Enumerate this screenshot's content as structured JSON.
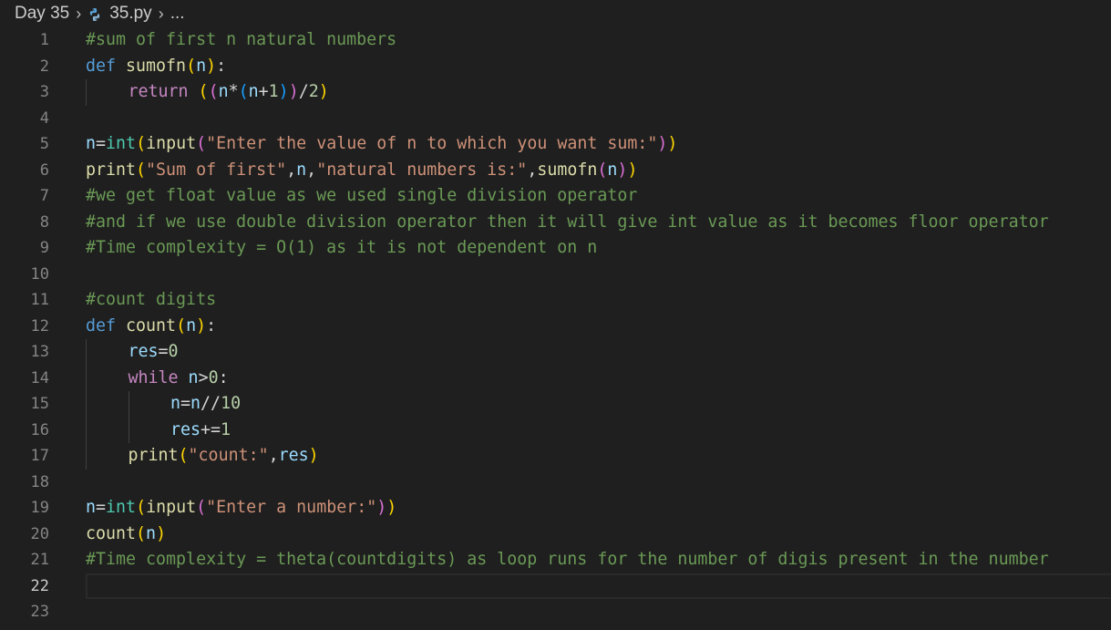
{
  "breadcrumb": {
    "folder": "Day 35",
    "file": "35.py",
    "more": "...",
    "file_icon": "python-file-icon",
    "separator_icon": "chevron-right-icon"
  },
  "editor": {
    "current_line": 22,
    "colors": {
      "background": "#1f1f1f",
      "keyword": "#569cd6",
      "function": "#dcdcaa",
      "variable": "#9cdcfe",
      "string": "#ce9178",
      "number": "#b5cea8",
      "comment": "#6a9955",
      "control": "#c586c0",
      "builtin_class": "#4ec9b0",
      "bracket_1": "#ffd700",
      "bracket_2": "#da70d6",
      "bracket_3": "#179fff"
    },
    "lines": [
      {
        "n": "1",
        "indent": 0,
        "tokens": [
          [
            "com",
            "#sum of first n natural numbers"
          ]
        ]
      },
      {
        "n": "2",
        "indent": 0,
        "tokens": [
          [
            "kw",
            "def "
          ],
          [
            "fn",
            "sumofn"
          ],
          [
            "b1",
            "("
          ],
          [
            "var",
            "n"
          ],
          [
            "b1",
            ")"
          ],
          [
            "op",
            ":"
          ]
        ]
      },
      {
        "n": "3",
        "indent": 1,
        "tokens": [
          [
            "ctrl",
            "return "
          ],
          [
            "b1",
            "("
          ],
          [
            "b2",
            "("
          ],
          [
            "var",
            "n"
          ],
          [
            "op",
            "*"
          ],
          [
            "b3",
            "("
          ],
          [
            "var",
            "n"
          ],
          [
            "op",
            "+"
          ],
          [
            "num",
            "1"
          ],
          [
            "b3",
            ")"
          ],
          [
            "b2",
            ")"
          ],
          [
            "op",
            "/"
          ],
          [
            "num",
            "2"
          ],
          [
            "b1",
            ")"
          ]
        ]
      },
      {
        "n": "4",
        "indent": 0,
        "tokens": []
      },
      {
        "n": "5",
        "indent": 0,
        "tokens": [
          [
            "var",
            "n"
          ],
          [
            "op",
            "="
          ],
          [
            "cls",
            "int"
          ],
          [
            "b1",
            "("
          ],
          [
            "fn",
            "input"
          ],
          [
            "b2",
            "("
          ],
          [
            "str",
            "\"Enter the value of n to which you want sum:\""
          ],
          [
            "b2",
            ")"
          ],
          [
            "b1",
            ")"
          ]
        ]
      },
      {
        "n": "6",
        "indent": 0,
        "tokens": [
          [
            "fn",
            "print"
          ],
          [
            "b1",
            "("
          ],
          [
            "str",
            "\"Sum of first\""
          ],
          [
            "op",
            ","
          ],
          [
            "var",
            "n"
          ],
          [
            "op",
            ","
          ],
          [
            "str",
            "\"natural numbers is:\""
          ],
          [
            "op",
            ","
          ],
          [
            "fn",
            "sumofn"
          ],
          [
            "b2",
            "("
          ],
          [
            "var",
            "n"
          ],
          [
            "b2",
            ")"
          ],
          [
            "b1",
            ")"
          ]
        ]
      },
      {
        "n": "7",
        "indent": 0,
        "tokens": [
          [
            "com",
            "#we get float value as we used single division operator"
          ]
        ]
      },
      {
        "n": "8",
        "indent": 0,
        "tokens": [
          [
            "com",
            "#and if we use double division operator then it will give int value as it becomes floor operator"
          ]
        ]
      },
      {
        "n": "9",
        "indent": 0,
        "tokens": [
          [
            "com",
            "#Time complexity = O(1) as it is not dependent on n"
          ]
        ]
      },
      {
        "n": "10",
        "indent": 0,
        "tokens": []
      },
      {
        "n": "11",
        "indent": 0,
        "tokens": [
          [
            "com",
            "#count digits"
          ]
        ]
      },
      {
        "n": "12",
        "indent": 0,
        "tokens": [
          [
            "kw",
            "def "
          ],
          [
            "fn",
            "count"
          ],
          [
            "b1",
            "("
          ],
          [
            "var",
            "n"
          ],
          [
            "b1",
            ")"
          ],
          [
            "op",
            ":"
          ]
        ]
      },
      {
        "n": "13",
        "indent": 1,
        "tokens": [
          [
            "var",
            "res"
          ],
          [
            "op",
            "="
          ],
          [
            "num",
            "0"
          ]
        ]
      },
      {
        "n": "14",
        "indent": 1,
        "tokens": [
          [
            "ctrl",
            "while "
          ],
          [
            "var",
            "n"
          ],
          [
            "op",
            ">"
          ],
          [
            "num",
            "0"
          ],
          [
            "op",
            ":"
          ]
        ]
      },
      {
        "n": "15",
        "indent": 2,
        "tokens": [
          [
            "var",
            "n"
          ],
          [
            "op",
            "="
          ],
          [
            "var",
            "n"
          ],
          [
            "op",
            "//"
          ],
          [
            "num",
            "10"
          ]
        ]
      },
      {
        "n": "16",
        "indent": 2,
        "tokens": [
          [
            "var",
            "res"
          ],
          [
            "op",
            "+="
          ],
          [
            "num",
            "1"
          ]
        ]
      },
      {
        "n": "17",
        "indent": 1,
        "tokens": [
          [
            "fn",
            "print"
          ],
          [
            "b1",
            "("
          ],
          [
            "str",
            "\"count:\""
          ],
          [
            "op",
            ","
          ],
          [
            "var",
            "res"
          ],
          [
            "b1",
            ")"
          ]
        ]
      },
      {
        "n": "18",
        "indent": 0,
        "tokens": []
      },
      {
        "n": "19",
        "indent": 0,
        "tokens": [
          [
            "var",
            "n"
          ],
          [
            "op",
            "="
          ],
          [
            "cls",
            "int"
          ],
          [
            "b1",
            "("
          ],
          [
            "fn",
            "input"
          ],
          [
            "b2",
            "("
          ],
          [
            "str",
            "\"Enter a number:\""
          ],
          [
            "b2",
            ")"
          ],
          [
            "b1",
            ")"
          ]
        ]
      },
      {
        "n": "20",
        "indent": 0,
        "tokens": [
          [
            "fn",
            "count"
          ],
          [
            "b1",
            "("
          ],
          [
            "var",
            "n"
          ],
          [
            "b1",
            ")"
          ]
        ]
      },
      {
        "n": "21",
        "indent": 0,
        "tokens": [
          [
            "com",
            "#Time complexity = theta(countdigits) as loop runs for the number of digis present in the number"
          ]
        ]
      },
      {
        "n": "22",
        "indent": 0,
        "tokens": []
      },
      {
        "n": "23",
        "indent": 0,
        "tokens": []
      }
    ]
  }
}
